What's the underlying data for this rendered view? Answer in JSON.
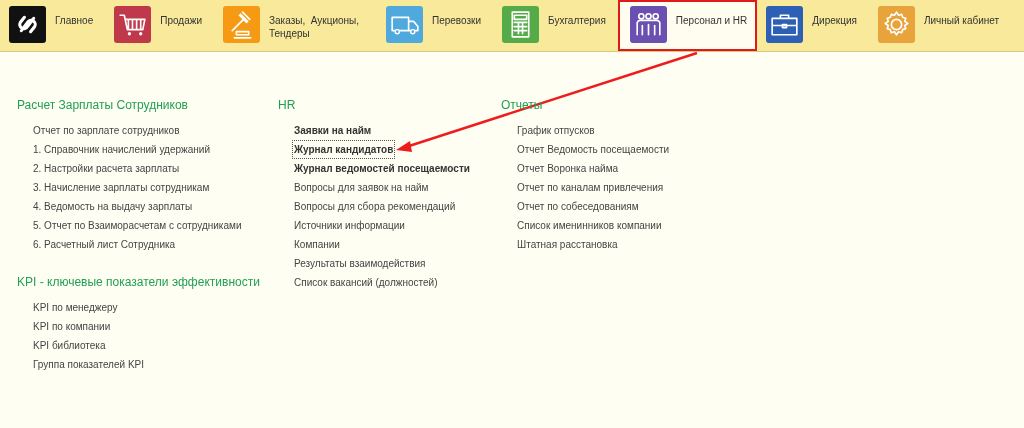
{
  "nav": [
    {
      "label": "Главное",
      "color": "#111111",
      "selected": false
    },
    {
      "label": "Продажи",
      "color": "#c0394b",
      "selected": false
    },
    {
      "label": "Заказы,  Аукционы, Тендеры",
      "color": "#f59a12",
      "selected": false
    },
    {
      "label": "Перевозки",
      "color": "#4fa9dc",
      "selected": false
    },
    {
      "label": "Бухгалтерия",
      "color": "#55ab48",
      "selected": false
    },
    {
      "label": "Персонал и HR",
      "color": "#6a50b0",
      "selected": true
    },
    {
      "label": "Дирекция",
      "color": "#2d5fb5",
      "selected": false
    },
    {
      "label": "Личный кабинет",
      "color": "#e8a33b",
      "selected": false
    }
  ],
  "columns": [
    {
      "sections": [
        {
          "title": "Расчет Зарплаты Сотрудников",
          "items": [
            {
              "label": "Отчет по зарплате сотрудников",
              "kind": "plain",
              "focused": false
            },
            {
              "label": "1. Справочник начислений удержаний",
              "kind": "plain",
              "focused": false
            },
            {
              "label": "2. Настройки расчета зарплаты",
              "kind": "plain",
              "focused": false
            },
            {
              "label": "3. Начисление зарплаты сотрудникам",
              "kind": "plain",
              "focused": false
            },
            {
              "label": "4. Ведомость на выдачу зарплаты",
              "kind": "plain",
              "focused": false
            },
            {
              "label": "5. Отчет по Взаиморасчетам с сотрудниками",
              "kind": "plain",
              "focused": false
            },
            {
              "label": "6. Расчетный лист Сотрудника",
              "kind": "plain",
              "focused": false
            }
          ]
        },
        {
          "title": "KPI - ключевые показатели эффективности",
          "items": [
            {
              "label": "KPI по менеджеру",
              "kind": "plain",
              "focused": false
            },
            {
              "label": "KPI по компании",
              "kind": "plain",
              "focused": false
            },
            {
              "label": "KPI библиотека",
              "kind": "plain",
              "focused": false
            },
            {
              "label": "Группа показателей KPI",
              "kind": "plain",
              "focused": false
            }
          ]
        }
      ]
    },
    {
      "sections": [
        {
          "title": "HR",
          "items": [
            {
              "label": "Заявки на найм",
              "kind": "bold",
              "focused": false
            },
            {
              "label": "Журнал кандидатов",
              "kind": "bold",
              "focused": true
            },
            {
              "label": "Журнал ведомостей посещаемости",
              "kind": "bold",
              "focused": false
            },
            {
              "label": "Вопросы для заявок на найм",
              "kind": "plain",
              "focused": false
            },
            {
              "label": "Вопросы для сбора рекомендаций",
              "kind": "plain",
              "focused": false
            },
            {
              "label": "Источники информации",
              "kind": "plain",
              "focused": false
            },
            {
              "label": "Компании",
              "kind": "plain",
              "focused": false
            },
            {
              "label": "Результаты взаимодействия",
              "kind": "plain",
              "focused": false
            },
            {
              "label": "Список вакансий (должностей)",
              "kind": "plain",
              "focused": false
            }
          ]
        }
      ]
    },
    {
      "sections": [
        {
          "title": "Отчеты",
          "items": [
            {
              "label": "График отпусков",
              "kind": "plain",
              "focused": false
            },
            {
              "label": "Отчет Ведомость посещаемости",
              "kind": "plain",
              "focused": false
            },
            {
              "label": "Отчет Воронка найма",
              "kind": "plain",
              "focused": false
            },
            {
              "label": "Отчет по каналам привлечения",
              "kind": "plain",
              "focused": false
            },
            {
              "label": "Отчет по собеседованиям",
              "kind": "plain",
              "focused": false
            },
            {
              "label": "Список именинников компании",
              "kind": "plain",
              "focused": false
            },
            {
              "label": "Штатная расстановка",
              "kind": "plain",
              "focused": false
            }
          ]
        }
      ]
    }
  ],
  "callout": {
    "kind": "arrow"
  }
}
